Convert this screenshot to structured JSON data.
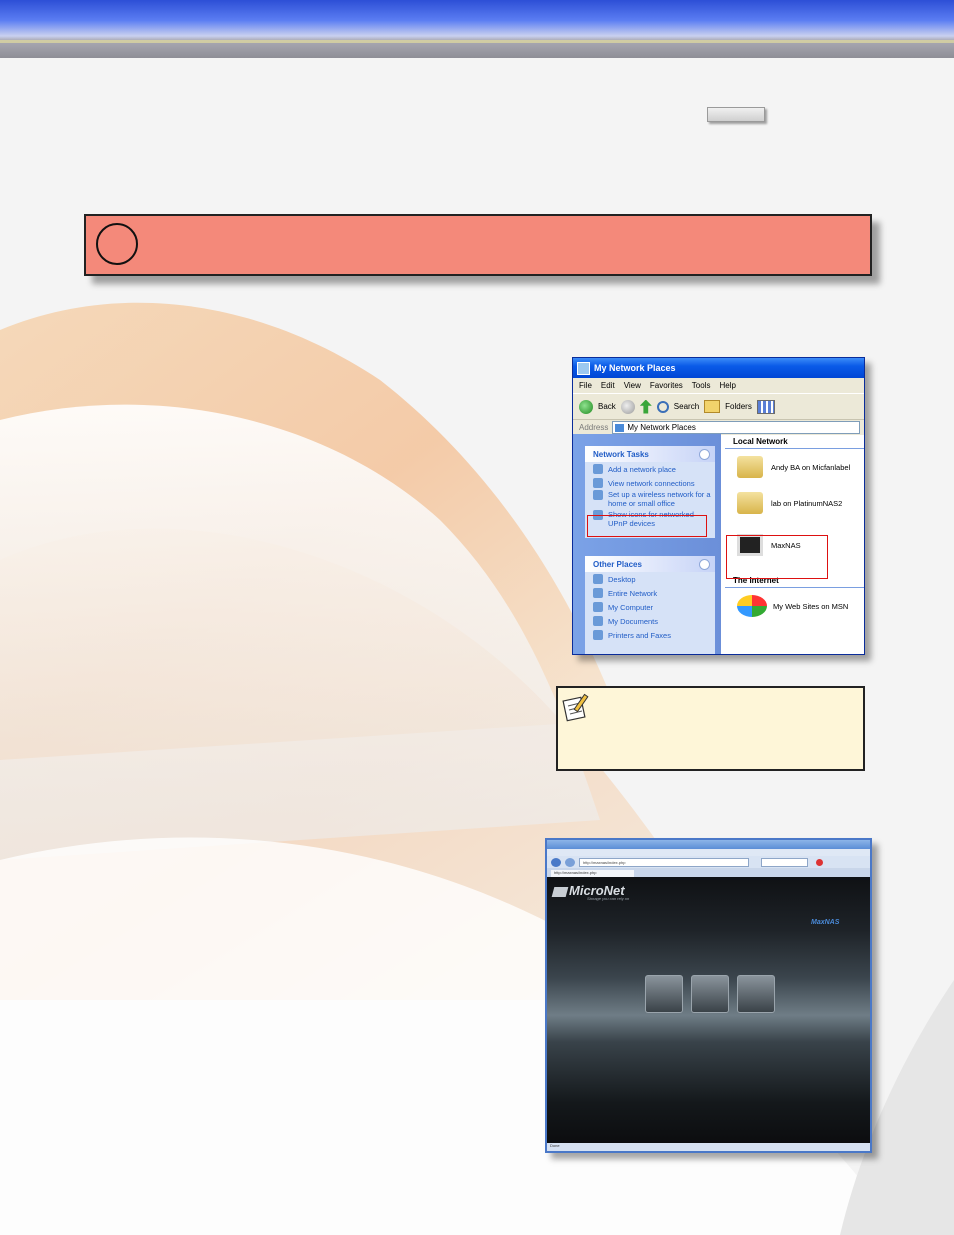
{
  "explorer": {
    "title": "My Network Places",
    "menu": [
      "File",
      "Edit",
      "View",
      "Favorites",
      "Tools",
      "Help"
    ],
    "toolbar": {
      "back": "Back",
      "search": "Search",
      "folders": "Folders"
    },
    "address": {
      "label": "Address",
      "value": "My Network Places"
    },
    "network_tasks": {
      "heading": "Network Tasks",
      "items": [
        "Add a network place",
        "View network connections",
        "Set up a wireless network for a home or small office",
        "Show icons for networked UPnP devices"
      ]
    },
    "other_places": {
      "heading": "Other Places",
      "items": [
        "Desktop",
        "Entire Network",
        "My Computer",
        "My Documents",
        "Printers and Faxes"
      ]
    },
    "local_network": {
      "heading": "Local Network",
      "items": [
        "Andy BA on Micfanlabel",
        "lab on PlatinumNAS2",
        "MaxNAS"
      ]
    },
    "internet": {
      "heading": "The Internet",
      "items": [
        "My Web Sites on MSN"
      ]
    }
  },
  "browser": {
    "url": "http://maxnas/index.php",
    "tab": "http://maxnas/index.php",
    "brand": "MicroNet",
    "tagline": "Storage you can rely on",
    "product": "MaxNAS",
    "status": "Done"
  },
  "colors": {
    "step_banner": "#f4897a",
    "note_background": "#fef6d8",
    "header_blue": "#2d4fd6"
  }
}
